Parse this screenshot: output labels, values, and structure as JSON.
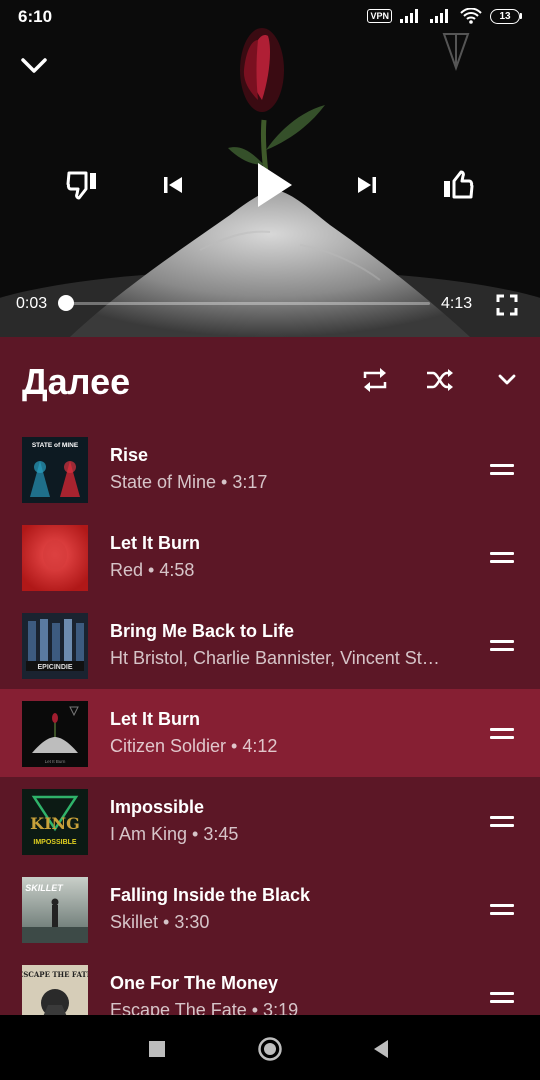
{
  "status_bar": {
    "time": "6:10",
    "vpn_label": "VPN",
    "battery": "13",
    "icons": [
      "vpn-icon",
      "signal-icon",
      "signal-icon",
      "wifi-icon",
      "battery-icon"
    ]
  },
  "player": {
    "current_time": "0:03",
    "total_time": "4:13",
    "progress_fraction": 0.012,
    "controls": [
      "collapse-icon",
      "thumbs-down-icon",
      "skip-previous-icon",
      "play-icon",
      "skip-next-icon",
      "thumbs-up-icon",
      "fullscreen-icon"
    ]
  },
  "queue": {
    "title": "Далее",
    "tracks": [
      {
        "title": "Rise",
        "subtitle": "State of Mine • 3:17",
        "art": "state-of-mine-cover",
        "active": false
      },
      {
        "title": "Let It Burn",
        "subtitle": "Red • 4:58",
        "art": "red-cover",
        "active": false
      },
      {
        "title": "Bring Me Back to Life",
        "subtitle": "Ht Bristol, Charlie Bannister, Vincent St…",
        "art": "epic-indie-cover",
        "active": false
      },
      {
        "title": "Let It Burn",
        "subtitle": "Citizen Soldier • 4:12",
        "art": "citizen-soldier-cover",
        "active": true
      },
      {
        "title": "Impossible",
        "subtitle": "I Am King • 3:45",
        "art": "i-am-king-cover",
        "active": false
      },
      {
        "title": "Falling Inside the Black",
        "subtitle": "Skillet • 3:30",
        "art": "skillet-cover",
        "active": false
      },
      {
        "title": "One For The Money",
        "subtitle": "Escape The Fate • 3:19",
        "art": "escape-the-fate-cover",
        "active": false
      }
    ]
  },
  "colors": {
    "queue_bg": "#5c1726",
    "active_row": "#861f33"
  }
}
